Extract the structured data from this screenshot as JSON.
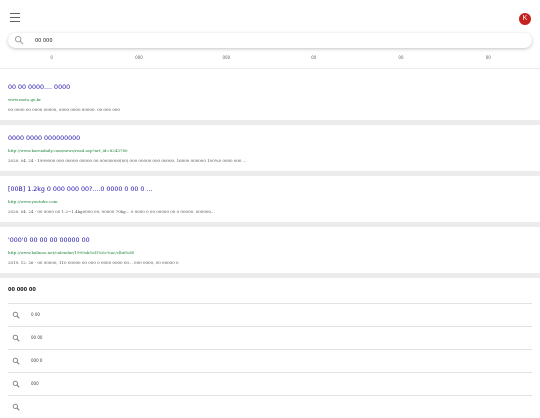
{
  "header": {
    "avatar_letter": "K",
    "avatar_color": "#c5221f"
  },
  "search": {
    "query": "00 000"
  },
  "tabs": [
    {
      "label": "0"
    },
    {
      "label": "000"
    },
    {
      "label": "000"
    },
    {
      "label": "00"
    },
    {
      "label": "00"
    },
    {
      "label": "00"
    }
  ],
  "results": [
    {
      "title": "00 00 0000.... 0000",
      "url": "www.moto.go.kr",
      "snippet": "00 0000 00 0000 00000, 0000 0000 00000. 00 000 000"
    },
    {
      "title": "0000 0000 000000000",
      "url": "http://www.koreadaily.com/news/read.asp?art_id=8243780",
      "snippet": "2020. 04. 24 - 1999000 000 00000 00000 00 00000000(00) 000 00000 000 00000. 16000 000000 100%0 0000 000 ..."
    },
    {
      "title": "[00B] 1.2kg 0 000 000 00?....0 0000 0 00 0 ...",
      "url": "http://www.youtube.com",
      "snippet": "2020. 04. 24 - 00 0000 00 1.2~1.4kg0000 00, 00000 70kg... 0 0000 0 00 00000 00 0 00000. 000000..."
    },
    {
      "title": "'000'0 00 00 00 00000 00",
      "url": "http://www.halmoo.net/calendar/1999ok%d1%6c%ac/clb6%d0",
      "snippet": "2019. 12. 26 - 00 00000, 110 00000 00 000 0 0000 0000 00... 000 0000, 00 00000 0"
    }
  ],
  "related": {
    "heading": "00 000 00",
    "items": [
      {
        "label": "0 00"
      },
      {
        "label": "00 00"
      },
      {
        "label": "000 0"
      },
      {
        "label": "000"
      }
    ]
  }
}
